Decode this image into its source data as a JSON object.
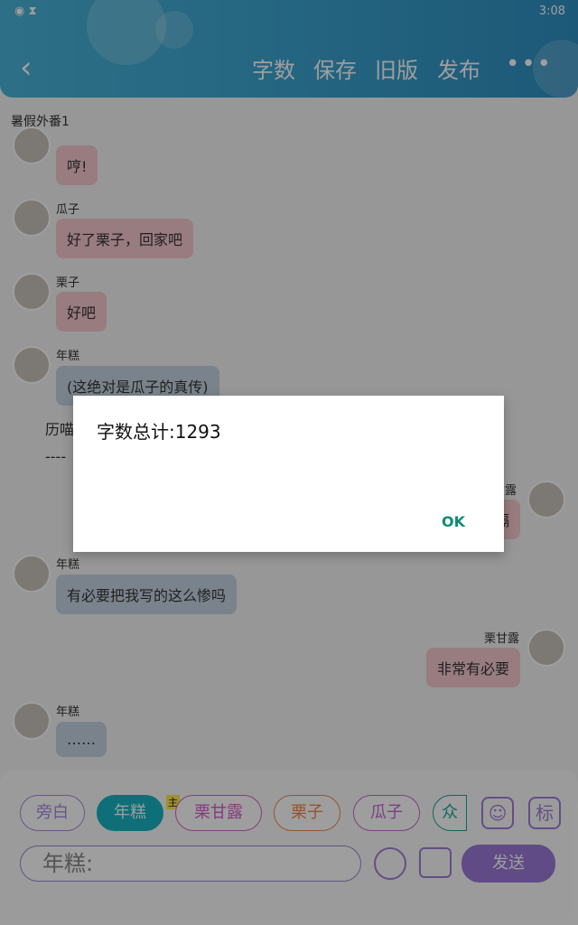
{
  "status": {
    "left_icons": "wifi-icon hourglass-icon",
    "time": "3:08"
  },
  "header": {
    "buttons": [
      "字数",
      "保存",
      "旧版",
      "发布"
    ],
    "more_label": "•••"
  },
  "book_title": "暑假外番1",
  "messages": [
    {
      "name": "",
      "text": "哼!"
    },
    {
      "name": "瓜子",
      "text": "好了栗子，回家吧"
    },
    {
      "name": "栗子",
      "text": "好吧"
    },
    {
      "name": "年糕",
      "text": "(这绝对是瓜子的真传)"
    },
    {
      "name": "年糕",
      "text": "有必要把我写的这么惨吗"
    },
    {
      "name": "栗甘露",
      "text": "非常有必要"
    },
    {
      "name": "年糕",
      "text": "……"
    }
  ],
  "narration": {
    "text": "历喵",
    "dash": "----"
  },
  "partial_right": {
    "name": "甘露",
    "text": "隔"
  },
  "chips": [
    "旁白",
    "年糕",
    "栗甘露",
    "栗子",
    "瓜子",
    "众"
  ],
  "chip_tag": "主",
  "tool_icons": {
    "person": "person-icon",
    "mark": "标"
  },
  "input_placeholder": "年糕:",
  "send_label": "发送",
  "dialog": {
    "title": "字数总计:1293",
    "ok": "OK"
  },
  "colors": {
    "header": "#3aa2cf",
    "pink_bubble": "#f7c9cf",
    "blue_bubble": "#c5d4e2",
    "accent": "#9b79d8",
    "ok": "#0f8a76"
  }
}
